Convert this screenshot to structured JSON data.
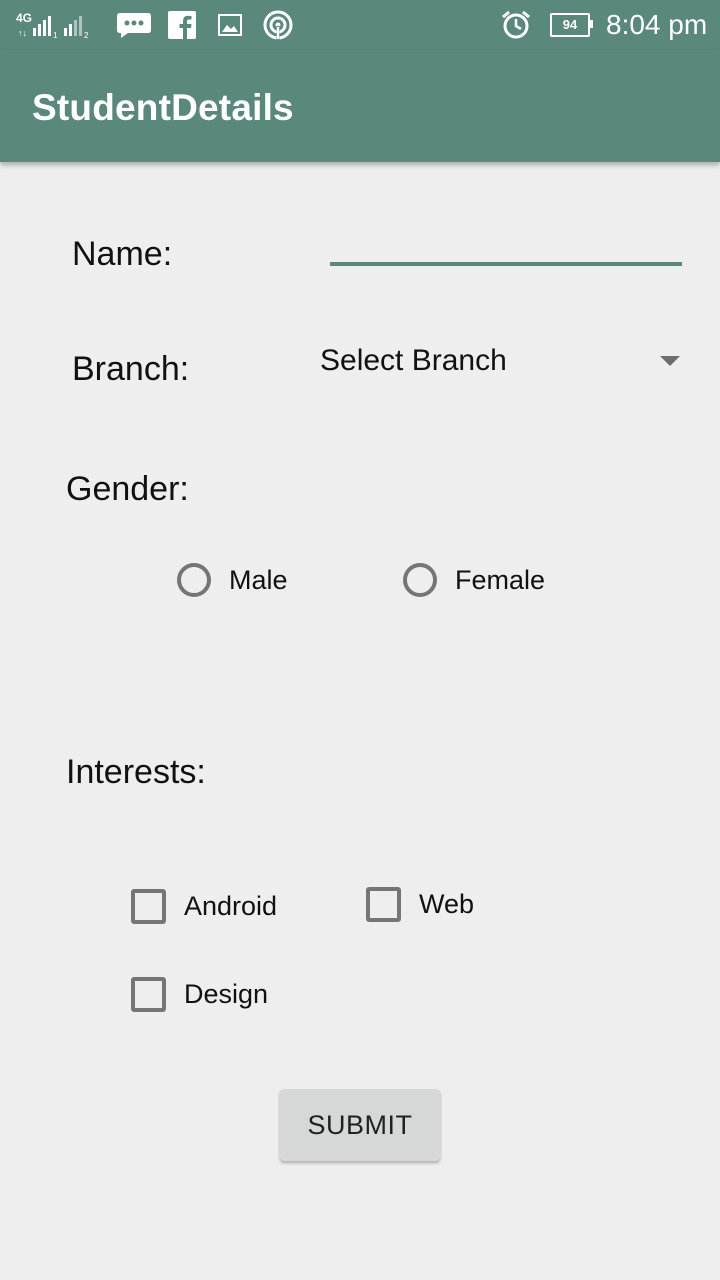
{
  "status_bar": {
    "network": "4G",
    "sim1": "1",
    "sim2": "2",
    "battery": "94",
    "time": "8:04 pm",
    "icons": [
      "signal-icon",
      "message-icon",
      "facebook-icon",
      "image-icon",
      "hotspot-icon",
      "alarm-icon",
      "battery-icon"
    ],
    "background": "#5a887b"
  },
  "app_bar": {
    "title": "StudentDetails",
    "background": "#5a887b"
  },
  "form": {
    "name_label": "Name:",
    "name_value": "",
    "branch_label": "Branch:",
    "branch_selected": "Select Branch",
    "gender_label": "Gender:",
    "gender_options": [
      "Male",
      "Female"
    ],
    "interests_label": "Interests:",
    "interest_options": [
      "Android",
      "Web",
      "Design"
    ],
    "submit_label": "SUBMIT"
  }
}
